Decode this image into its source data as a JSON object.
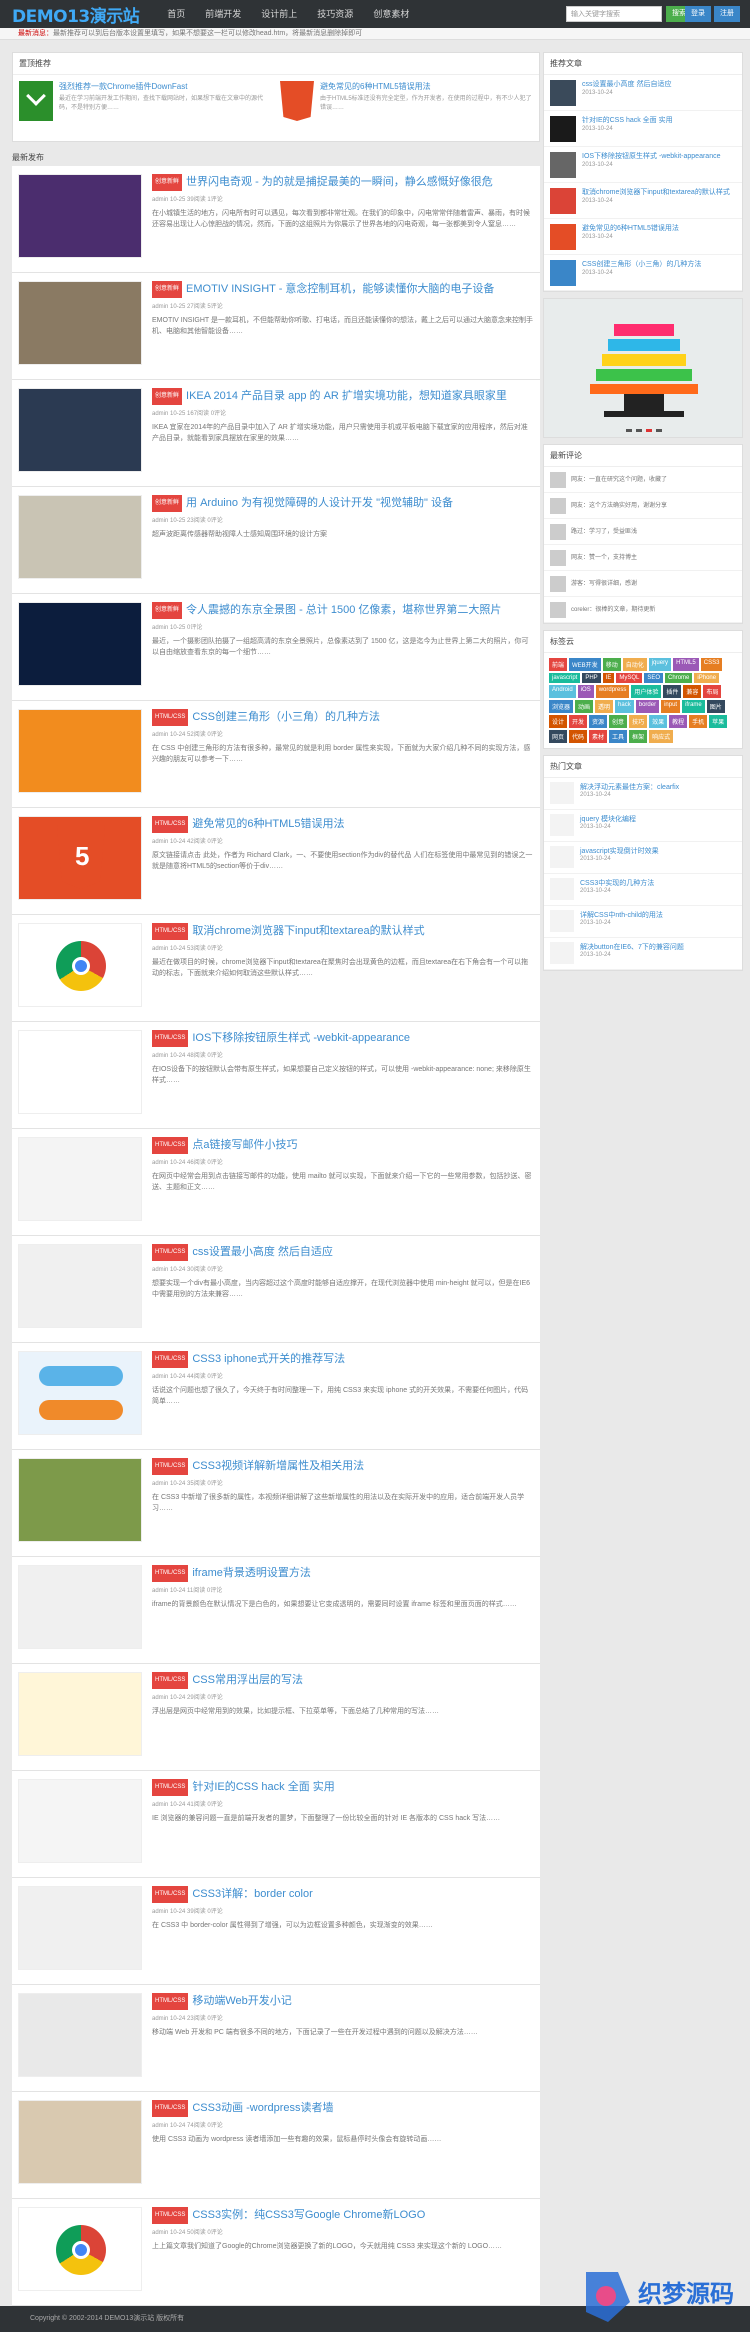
{
  "header": {
    "logo": "DEMO13演示站",
    "nav": [
      "首页",
      "前端开发",
      "设计前上",
      "技巧资源",
      "创意素材"
    ],
    "search_placeholder": "输入关键字搜索",
    "search_btn": "搜索",
    "btn1": "登录",
    "btn2": "注册"
  },
  "notice": {
    "label": "最新消息：",
    "text": "最新推荐可以到后台版本设置里填写，如果不想要这一栏可以修改head.htm，将最新消息删除掉即可"
  },
  "recommend": {
    "title": "置顶推荐",
    "items": [
      {
        "t": "强烈推荐一款Chrome插件DownFast",
        "d": "最近在学习前端开发工作期间，查找下载网站时，如果想下载在文章中的源代码，不是特别方便……"
      },
      {
        "t": "避免常见的6种HTML5错误用法",
        "d": "由于HTML5标准还没有完全定型，作为开发者，在使用的过程中，有不少人犯了错误……"
      }
    ]
  },
  "latest_title": "最新发布",
  "posts": [
    {
      "tag": "创意新鲜",
      "t": "世界闪电奇观 - 为的就是捕捉最美的一瞬间，静么感慨好像很危",
      "m": "admin  10-25  39阅读  1评论",
      "e": "在小城镇生活的地方，闪电所有时可以遇见，每次看到都非常壮观。在我们的印象中，闪电常常伴随着雷声、暴雨，有时候还容易出现让人心惊胆战的情况，然而，下面的这组照片为你展示了世界各地的闪电奇观，每一张都美到令人窒息……"
    },
    {
      "tag": "创意新鲜",
      "t": "EMOTIV INSIGHT - 意念控制耳机，能够读懂你大脑的电子设备",
      "m": "admin  10-25  27阅读  5评论",
      "e": "EMOTIV INSIGHT 是一款耳机，不但能帮助你听歌、打电话，而且还能读懂你的想法，戴上之后可以通过大脑意念来控制手机、电脑和其他智能设备……"
    },
    {
      "tag": "创意新鲜",
      "t": "IKEA 2014 产品目录 app 的 AR 扩增实境功能，想知道家具眼家里",
      "m": "admin  10-25  167阅读  0评论",
      "e": "IKEA 宜家在2014年的产品目录中加入了 AR 扩增实境功能，用户只需使用手机或平板电脑下载宜家的应用程序，然后对准产品目录，就能看到家具摆放在家里的效果……"
    },
    {
      "tag": "创意新鲜",
      "t": "用 Arduino 为有视觉障碍的人设计开发 \"视觉辅助\" 设备",
      "m": "admin  10-25  23阅读  0评论",
      "e": "超声波距离传感器帮助视障人士感知周围环境的设计方案"
    },
    {
      "tag": "创意新鲜",
      "t": "令人震撼的东京全景图 - 总计 1500 亿像素，堪称世界第二大照片",
      "m": "admin  10-25  0评论",
      "e": "最近，一个摄影团队拍摄了一组超高清的东京全景照片，总像素达到了 1500 亿，这是迄今为止世界上第二大的照片，你可以自由缩放查看东京的每一个细节……"
    },
    {
      "tag": "HTML/CSS",
      "t": "CSS创建三角形（小三角）的几种方法",
      "m": "admin  10-24  52阅读  0评论",
      "e": "在 CSS 中创建三角形的方法有很多种，最常见的就是利用 border 属性来实现，下面就为大家介绍几种不同的实现方法，感兴趣的朋友可以参考一下……"
    },
    {
      "tag": "HTML/CSS",
      "t": "避免常见的6种HTML5错误用法",
      "m": "admin  10-24  42阅读  0评论",
      "e": "原文链接请点击 此处，作者为 Richard Clark，一、不要使用section作为div的替代品 人们在标签使用中最常见到的错误之一就是随意将HTML5的section等价于div……"
    },
    {
      "tag": "HTML/CSS",
      "t": "取消chrome浏览器下input和textarea的默认样式",
      "m": "admin  10-24  53阅读  0评论",
      "e": "最近在做项目的时候，chrome浏览器下input和textarea在聚焦时会出现黄色的边框，而且textarea在右下角会有一个可以拖动的标志，下面就来介绍如何取消这些默认样式……"
    },
    {
      "tag": "HTML/CSS",
      "t": "IOS下移除按钮原生样式 -webkit-appearance",
      "m": "admin  10-24  48阅读  0评论",
      "e": "在IOS设备下的按钮默认会带有原生样式，如果想要自己定义按钮的样式，可以使用 -webkit-appearance: none; 来移除原生样式……"
    },
    {
      "tag": "HTML/CSS",
      "t": "点a链接写邮件小技巧",
      "m": "admin  10-24  46阅读  0评论",
      "e": "在网页中经常会用到点击链接写邮件的功能，使用 mailto 就可以实现，下面就来介绍一下它的一些常用参数，包括抄送、密送、主题和正文……"
    },
    {
      "tag": "HTML/CSS",
      "t": "css设置最小高度 然后自适应",
      "m": "admin  10-24  30阅读  0评论",
      "e": "想要实现一个div有最小高度，当内容超过这个高度时能够自适应撑开，在现代浏览器中使用 min-height 就可以，但是在IE6中需要用别的方法来兼容……"
    },
    {
      "tag": "HTML/CSS",
      "t": "CSS3 iphone式开关的推荐写法",
      "m": "admin  10-24  44阅读  0评论",
      "e": "话说这个问题也想了很久了，今天终于有时间整理一下，用纯 CSS3 来实现 iphone 式的开关效果，不需要任何图片，代码简单……"
    },
    {
      "tag": "HTML/CSS",
      "t": "CSS3视频详解新增属性及相关用法",
      "m": "admin  10-24  35阅读  0评论",
      "e": "在 CSS3 中新增了很多新的属性，本视频详细讲解了这些新增属性的用法以及在实际开发中的应用，适合前端开发人员学习……"
    },
    {
      "tag": "HTML/CSS",
      "t": "iframe背景透明设置方法",
      "m": "admin  10-24  11阅读  0评论",
      "e": "iframe的背景颜色在默认情况下是白色的，如果想要让它变成透明的，需要同时设置 iframe 标签和里面页面的样式……"
    },
    {
      "tag": "HTML/CSS",
      "t": "CSS常用浮出层的写法",
      "m": "admin  10-24  29阅读  0评论",
      "e": "浮出层是网页中经常用到的效果，比如提示框、下拉菜单等，下面总结了几种常用的写法……"
    },
    {
      "tag": "HTML/CSS",
      "t": "针对IE的CSS hack 全面 实用",
      "m": "admin  10-24  41阅读  0评论",
      "e": "IE 浏览器的兼容问题一直是前端开发者的噩梦，下面整理了一份比较全面的针对 IE 各版本的 CSS hack 写法……"
    },
    {
      "tag": "HTML/CSS",
      "t": "CSS3详解：border color",
      "m": "admin  10-24  39阅读  0评论",
      "e": "在 CSS3 中 border-color 属性得到了增强，可以为边框设置多种颜色，实现渐变的效果……"
    },
    {
      "tag": "HTML/CSS",
      "t": "移动端Web开发小记",
      "m": "admin  10-24  23阅读  0评论",
      "e": "移动端 Web 开发和 PC 端有很多不同的地方，下面记录了一些在开发过程中遇到的问题以及解决方法……"
    },
    {
      "tag": "HTML/CSS",
      "t": "CSS3动画 -wordpress读者墙",
      "m": "admin  10-24  74阅读  0评论",
      "e": "使用 CSS3 动画为 wordpress 读者墙添加一些有趣的效果，鼠标悬停时头像会有旋转动画……"
    },
    {
      "tag": "HTML/CSS",
      "t": "CSS3实例：纯CSS3写Google Chrome新LOGO",
      "m": "admin  10-24  50阅读  0评论",
      "e": "上上篇文章我们知道了Google的Chrome浏览器更换了新的LOGO，今天就用纯 CSS3 来实现这个新的 LOGO……"
    }
  ],
  "side_recent": {
    "title": "推荐文章",
    "items": [
      {
        "t": "css设置最小高度 然后自适应",
        "d": "2013-10-24"
      },
      {
        "t": "针对IE的CSS hack 全面 实用",
        "d": "2013-10-24"
      },
      {
        "t": "IOS下移除按钮原生样式 -webkit-appearance",
        "d": "2013-10-24"
      },
      {
        "t": "取消chrome浏览器下input和textarea的默认样式",
        "d": "2013-10-24"
      },
      {
        "t": "避免常见的6种HTML5错误用法",
        "d": "2013-10-24"
      },
      {
        "t": "CSS创建三角形（小三角）的几种方法",
        "d": "2013-10-24"
      }
    ]
  },
  "side_comments": {
    "title": "最新评论",
    "items": [
      "网友：一直在研究这个问题，收藏了",
      "网友：这个方法确实好用，谢谢分享",
      "路过：学习了，受益匪浅",
      "网友：赞一个，支持博主",
      "游客：写得很详细，感谢",
      "coreler：很棒的文章，期待更新"
    ]
  },
  "side_tags": {
    "title": "标签云",
    "items": [
      "前端",
      "WEB开发",
      "移动",
      "自动化",
      "jquery",
      "HTML5",
      "CSS3",
      "javascript",
      "PHP",
      "IE",
      "MySQL",
      "SEO",
      "Chrome",
      "iPhone",
      "Android",
      "iOS",
      "wordpress",
      "用户体验",
      "插件",
      "兼容",
      "布局",
      "浏览器",
      "动画",
      "透明",
      "hack",
      "border",
      "input",
      "iframe",
      "图片",
      "设计",
      "开发",
      "资源",
      "创意",
      "技巧",
      "效果",
      "教程",
      "手机",
      "苹果",
      "网页",
      "代码",
      "素材",
      "工具",
      "框架",
      "响应式"
    ]
  },
  "side_hot": {
    "title": "热门文章",
    "items": [
      {
        "t": "解决浮动元素最佳方案：clearfix",
        "d": "2013-10-24"
      },
      {
        "t": "jquery 模块化编程",
        "d": "2013-10-24"
      },
      {
        "t": "javascript实现倒计时效果",
        "d": "2013-10-24"
      },
      {
        "t": "CSS3中实现的几种方法",
        "d": "2013-10-24"
      },
      {
        "t": "详解CSS中nth-child的用法",
        "d": "2013-10-24"
      },
      {
        "t": "解决button在IE6、7下的兼容问题",
        "d": "2013-10-24"
      }
    ]
  },
  "footer": "Copyright © 2002-2014 DEMO13演示站 版权所有",
  "watermark": "织梦源码"
}
